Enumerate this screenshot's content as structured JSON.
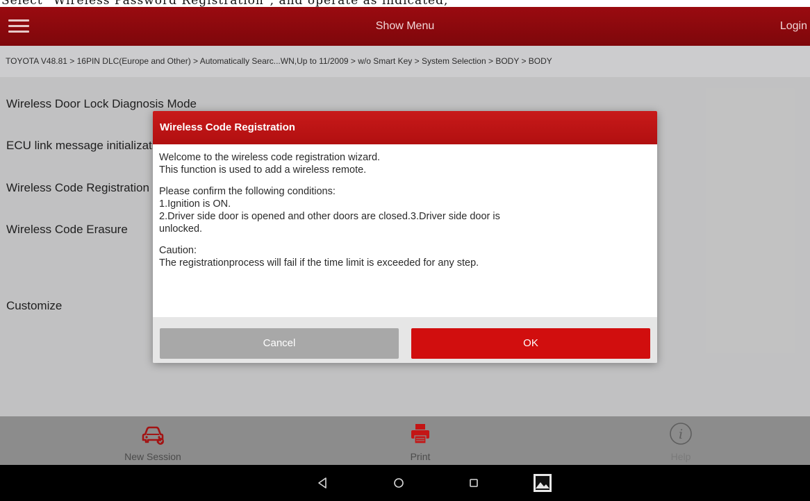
{
  "doc_header": {
    "text": "Select \"Wireless Password Registration\", and operate as indicated,"
  },
  "topbar": {
    "title": "Show Menu",
    "login_label": "Login"
  },
  "breadcrumb": {
    "text": "TOYOTA V48.81 > 16PIN DLC(Europe and Other) > Automatically Searc...WN,Up to 11/2009 > w/o Smart Key > System Selection > BODY > BODY"
  },
  "menu_items": [
    {
      "label": "Wireless Door Lock Diagnosis Mode"
    },
    {
      "label": "ECU link message initialization"
    },
    {
      "label": "Wireless Code Registration"
    },
    {
      "label": "Wireless Code Erasure"
    },
    {
      "label": "Customize"
    }
  ],
  "dialog": {
    "title": "Wireless Code Registration",
    "intro": "Welcome to the wireless code registration wizard.\nThis function is used to add a wireless remote.",
    "conditions": "Please confirm the following conditions:\n1.Ignition is ON.\n2.Driver side door is opened and other doors are closed.3.Driver side door is\nunlocked.",
    "caution": "Caution:\nThe registrationprocess will fail if the time limit is exceeded for any step.",
    "cancel_label": "Cancel",
    "ok_label": "OK"
  },
  "bottom_nav": {
    "new_session": "New Session",
    "print": "Print",
    "help": "Help"
  },
  "colors": {
    "brand_red": "#9a0b10",
    "ok_red": "#d10e0e",
    "cancel_gray": "#a8a8a8"
  },
  "icons": {
    "menu": "hamburger-icon",
    "new_session": "car-icon",
    "print": "printer-icon",
    "help": "info-icon",
    "back": "back-icon",
    "home": "home-icon",
    "recent": "recent-apps-icon",
    "screenshot": "gallery-icon"
  }
}
